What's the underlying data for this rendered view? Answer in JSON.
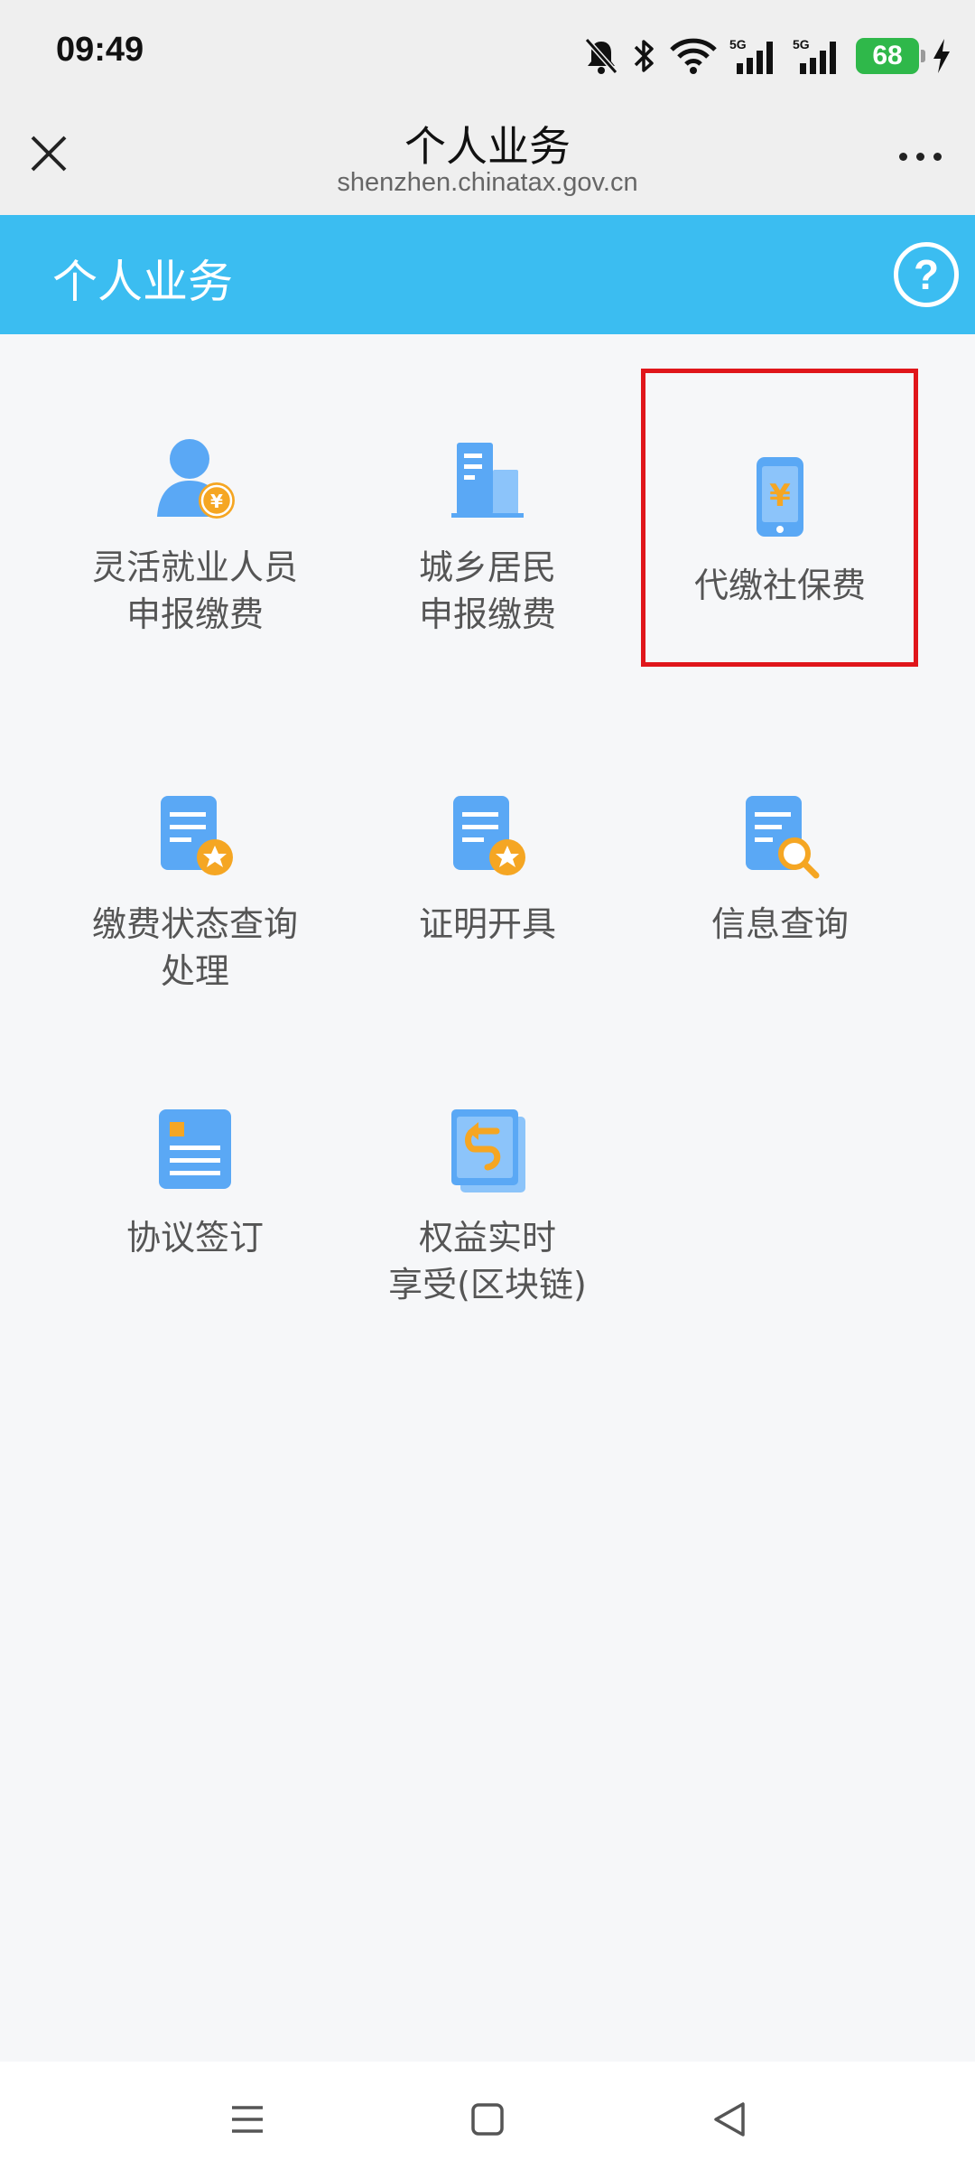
{
  "status_bar": {
    "time": "09:49",
    "battery": "68",
    "icons": [
      "mute-icon",
      "bluetooth-icon",
      "wifi-icon",
      "signal-5g-icon",
      "signal-5g-icon",
      "charging-icon"
    ]
  },
  "browser": {
    "title": "个人业务",
    "url": "shenzhen.chinatax.gov.cn"
  },
  "banner": {
    "title": "个人业务",
    "help": "?"
  },
  "services": [
    {
      "label": "灵活就业人员\n申报缴费",
      "icon": "person-yuan-icon"
    },
    {
      "label": "城乡居民\n申报缴费",
      "icon": "building-icon"
    },
    {
      "label": "代缴社保费",
      "icon": "phone-yuan-icon",
      "highlighted": true
    },
    {
      "label": "缴费状态查询\n处理",
      "icon": "document-star-icon"
    },
    {
      "label": "证明开具",
      "icon": "document-star-icon"
    },
    {
      "label": "信息查询",
      "icon": "document-search-icon"
    },
    {
      "label": "协议签订",
      "icon": "contract-icon"
    },
    {
      "label": "权益实时\n享受(区块链)",
      "icon": "book-icon"
    }
  ],
  "colors": {
    "banner": "#3bbdf1",
    "icon_blue": "#5aa8f5",
    "icon_orange": "#f5a623",
    "highlight": "#e0161b"
  }
}
